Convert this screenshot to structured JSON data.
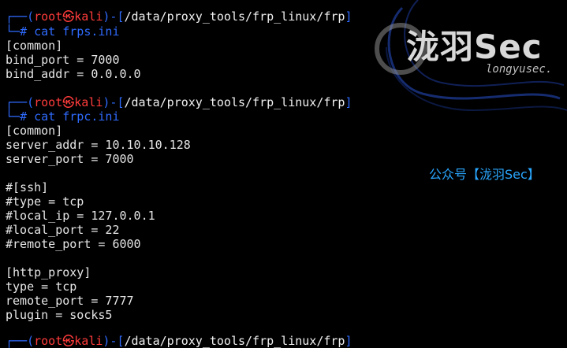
{
  "prompt1": {
    "bracket_open": "┌──(",
    "user": "root",
    "at_glyph": "㉿",
    "host": "kali",
    "sep": ")-[",
    "path": "/data/proxy_tools/frp_linux/frp",
    "close": "]",
    "symbol": "└─",
    "hash": "#",
    "command": "cat frps.ini"
  },
  "output1": [
    "[common]",
    "bind_port = 7000",
    "bind_addr = 0.0.0.0"
  ],
  "prompt2": {
    "bracket_open": "┌──(",
    "user": "root",
    "at_glyph": "㉿",
    "host": "kali",
    "sep": ")-[",
    "path": "/data/proxy_tools/frp_linux/frp",
    "close": "]",
    "symbol": "└─",
    "hash": "#",
    "command": "cat frpc.ini"
  },
  "output2": [
    "[common]",
    "server_addr = 10.10.10.128",
    "server_port = 7000",
    "",
    "#[ssh]",
    "#type = tcp",
    "#local_ip = 127.0.0.1",
    "#local_port = 22",
    "#remote_port = 6000",
    "",
    "[http_proxy]",
    "type = tcp",
    "remote_port = 7777",
    "plugin = socks5"
  ],
  "prompt3": {
    "bracket_open": "┌──(",
    "user": "root",
    "at_glyph": "㉿",
    "host": "kali",
    "sep": ")-[",
    "path": "/data/proxy_tools/frp_linux/frp",
    "close": "]"
  },
  "watermark": {
    "brand": "泷羽Sec",
    "domain": "longyusec.",
    "public_account": "公众号【泷羽Sec】"
  },
  "colors": {
    "background": "#000000",
    "prompt_frame": "#2f6bff",
    "user_host": "#ff3b3b",
    "text": "#e6e6e6",
    "watermark_public": "#2aa7ff"
  }
}
